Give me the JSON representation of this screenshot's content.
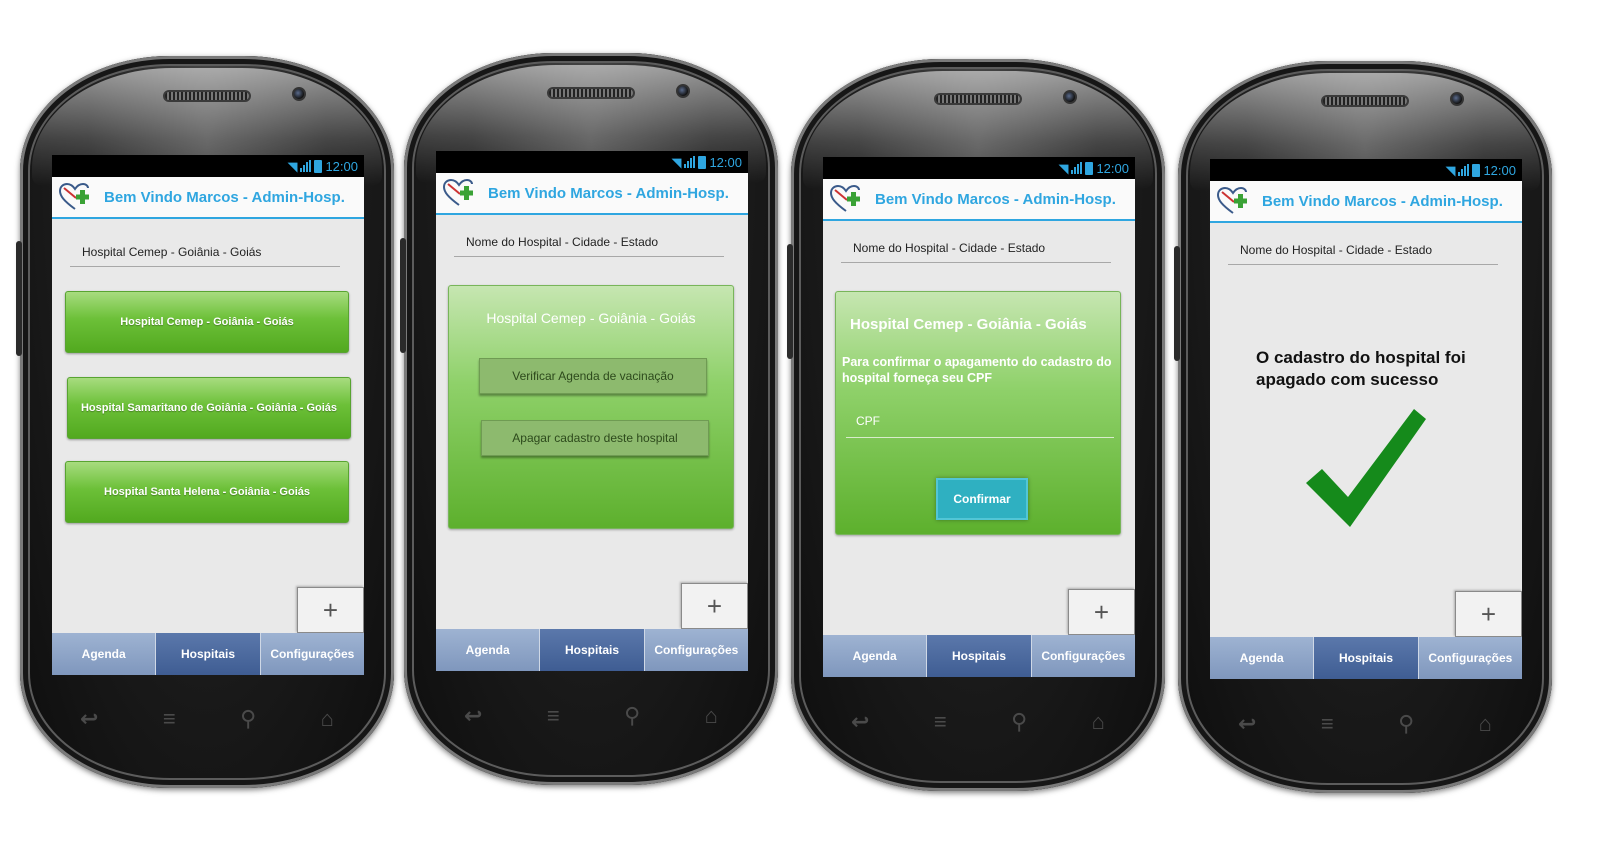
{
  "app": {
    "title": "Bem Vindo Marcos - Admin-Hosp.",
    "time": "12:00",
    "colors": {
      "accent": "#2fa6e0",
      "green": "#6cc038",
      "tab_active": "#4a679c",
      "tab": "#8ea4c8"
    }
  },
  "tabs": {
    "agenda": "Agenda",
    "hospitais": "Hospitais",
    "configuracoes": "Configurações"
  },
  "plus_label": "+",
  "screen1": {
    "search_value": "Hospital Cemep - Goiânia - Goiás",
    "hospitals": [
      "Hospital Cemep - Goiânia - Goiás",
      "Hospital Samaritano de Goiânia - Goiânia - Goiás",
      "Hospital Santa Helena - Goiânia - Goiás"
    ]
  },
  "screen2": {
    "search_placeholder": "Nome do Hospital - Cidade - Estado",
    "panel_title": "Hospital Cemep - Goiânia - Goiás",
    "btn_agenda": "Verificar Agenda de vacinação",
    "btn_apagar": "Apagar cadastro deste hospital"
  },
  "screen3": {
    "search_placeholder": "Nome do Hospital - Cidade - Estado",
    "panel_title": "Hospital Cemep - Goiânia - Goiás",
    "confirm_text": "Para confirmar o apagamento do cadastro do hospital forneça seu CPF",
    "cpf_placeholder": "CPF",
    "confirm_button": "Confirmar"
  },
  "screen4": {
    "search_placeholder": "Nome do Hospital - Cidade - Estado",
    "success_message": "O cadastro do hospital foi apagado com sucesso"
  }
}
